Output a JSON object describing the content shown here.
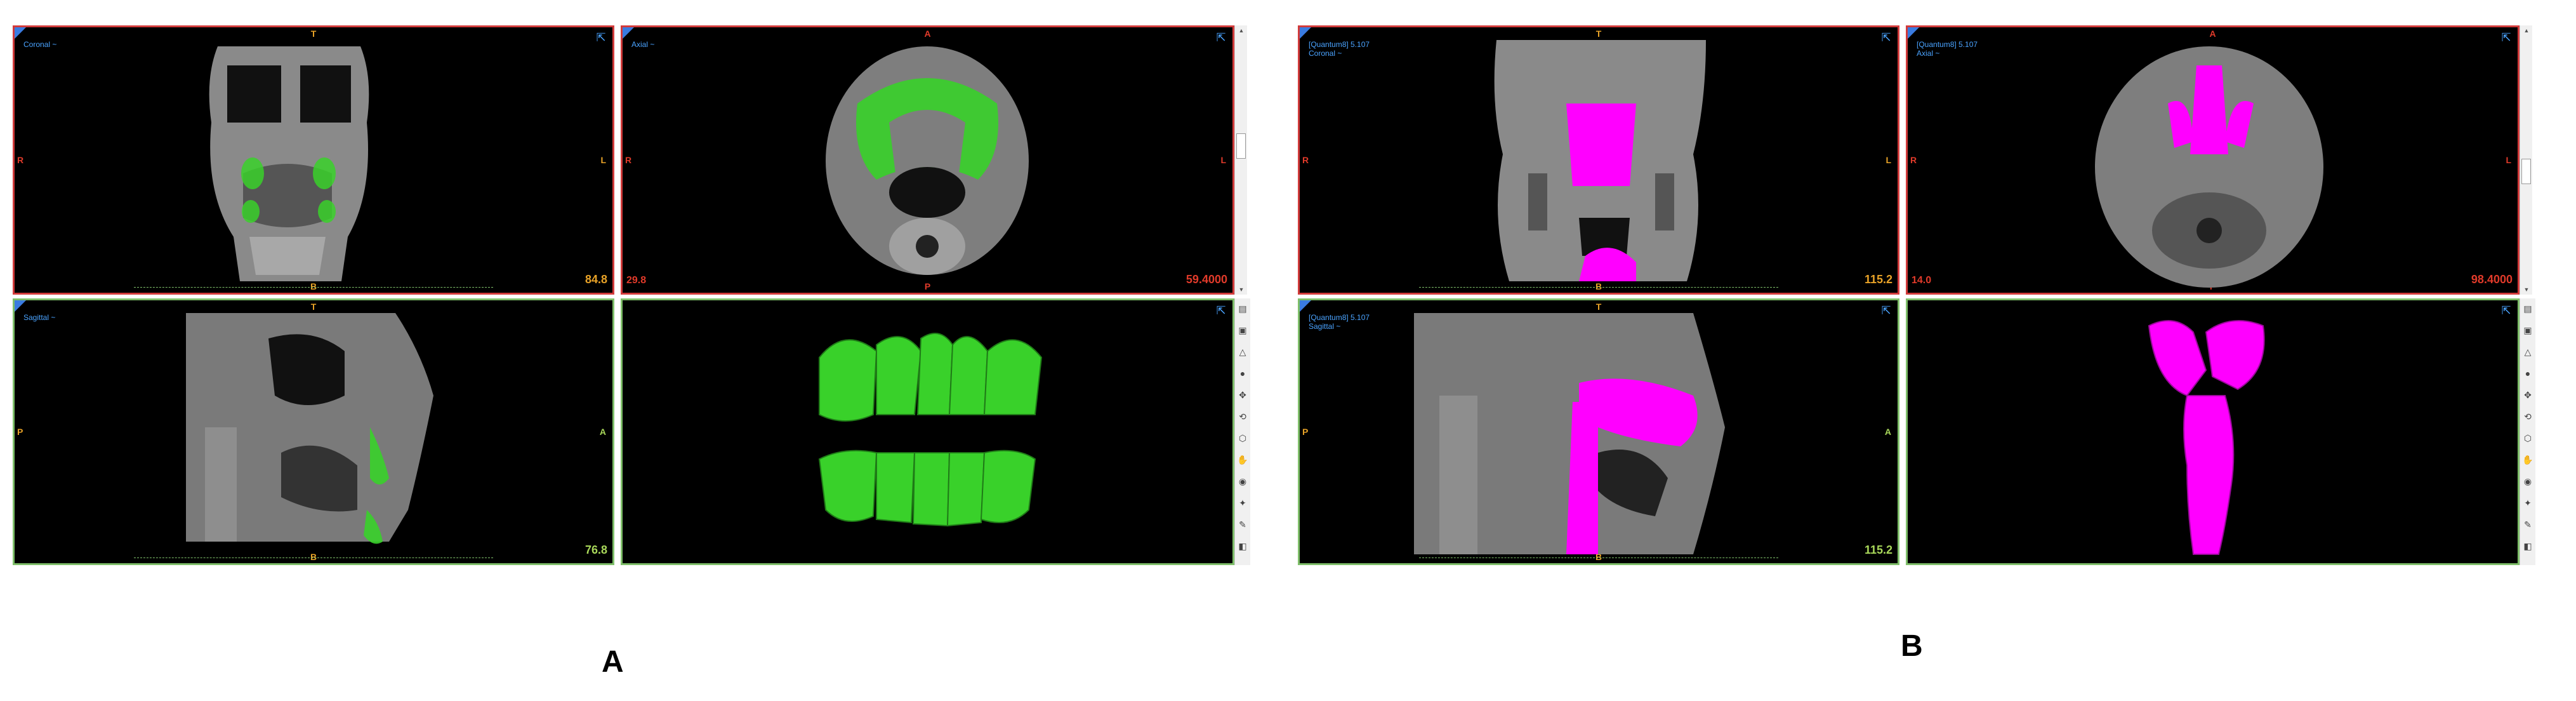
{
  "figure": {
    "caption_a": "A",
    "caption_b": "B"
  },
  "colors": {
    "segmentation_a": "#39d12a",
    "segmentation_b": "#ff00ff",
    "border_red": "#d23b3b",
    "border_green": "#7fbf6a",
    "label_blue": "#4aa3ff",
    "orient_orange": "#e8a227"
  },
  "panel_a": {
    "coronal": {
      "label": "Coronal ~",
      "top": "T",
      "bottom": "B",
      "left": "R",
      "right": "L",
      "slice": "84.8"
    },
    "axial": {
      "label": "Axial ~",
      "top": "A",
      "bottom": "P",
      "left": "R",
      "right": "L",
      "wl": "29.8",
      "slice": "59.4000"
    },
    "sagittal": {
      "label": "Sagittal ~",
      "top": "T",
      "bottom": "B",
      "left": "P",
      "right": "A",
      "slice": "76.8"
    },
    "render3d": {
      "description": "teeth"
    }
  },
  "panel_b": {
    "coronal": {
      "header": "[Quantum8] 5.107",
      "label": "Coronal ~",
      "top": "T",
      "bottom": "B",
      "left": "R",
      "right": "L",
      "slice": "115.2"
    },
    "axial": {
      "header": "[Quantum8] 5.107",
      "label": "Axial ~",
      "top": "A",
      "bottom": "P",
      "left": "R",
      "right": "L",
      "wl": "14.0",
      "slice": "98.4000"
    },
    "sagittal": {
      "header": "[Quantum8] 5.107",
      "label": "Sagittal ~",
      "top": "T",
      "bottom": "B",
      "left": "P",
      "right": "A",
      "slice": "115.2"
    },
    "render3d": {
      "description": "airway"
    }
  },
  "toolbar_icons": [
    "layers-icon",
    "cube-view-icon",
    "triangle-icon",
    "sphere-icon",
    "move-icon",
    "rotate-icon",
    "box-icon",
    "hand-icon",
    "eye-icon",
    "light-icon",
    "pen-icon",
    "reset-icon"
  ]
}
